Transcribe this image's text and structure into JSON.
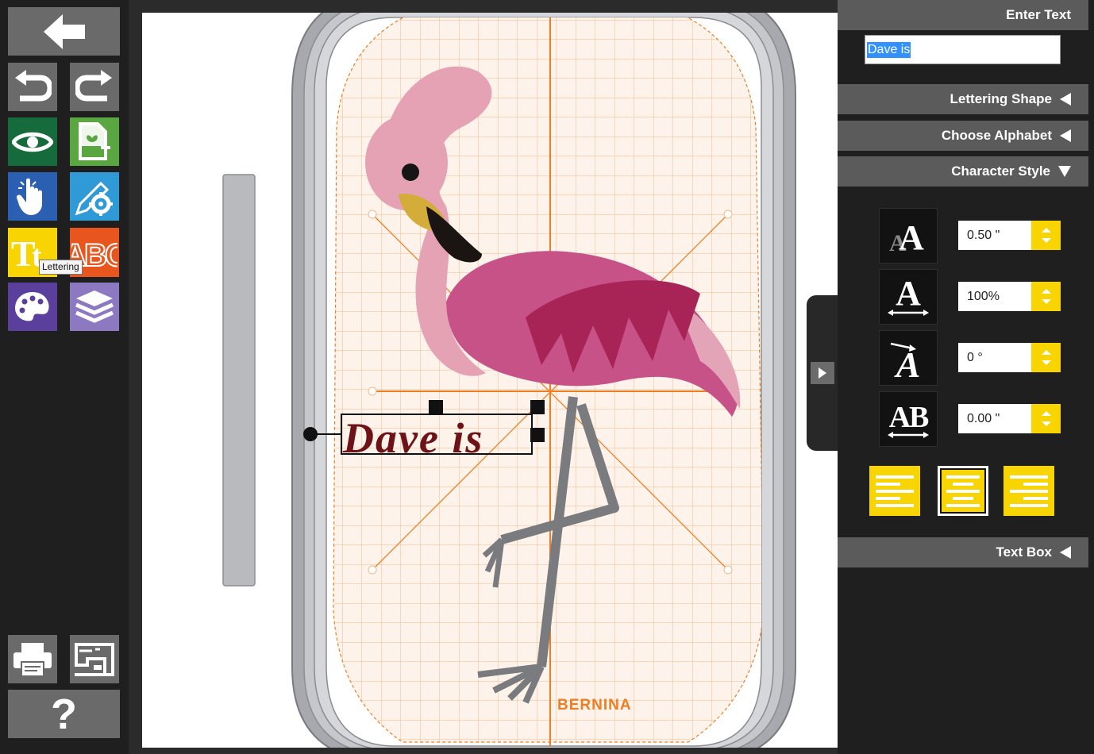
{
  "toolbar": {
    "back": "back-arrow-icon",
    "undo": "undo-icon",
    "redo": "redo-icon",
    "preview": "eye-icon",
    "new": "new-design-icon",
    "select": "hand-pointer-icon",
    "edit": "edit-gear-icon",
    "lettering": "lettering-icon",
    "monogram": "monogram-icon",
    "colors": "palette-icon",
    "layers": "layers-icon",
    "print": "printer-icon",
    "machine": "sewing-machine-icon",
    "help_label": "?",
    "tooltip": "Lettering"
  },
  "canvas": {
    "lettering_text": "Dave is",
    "brand_label": "BERNINA"
  },
  "panel": {
    "enter_text": {
      "title": "Enter Text",
      "value": "Dave is"
    },
    "sections": {
      "lettering_shape": "Lettering Shape",
      "choose_alphabet": "Choose Alphabet",
      "character_style": "Character Style",
      "text_box": "Text Box"
    },
    "character_style": {
      "size": "0.50 \"",
      "width": "100%",
      "slant": "0 °",
      "spacing": "0.00 \""
    },
    "alignment": {
      "options": [
        "left",
        "center",
        "right"
      ],
      "selected": "center"
    }
  },
  "colors": {
    "accent_yellow": "#f8d400",
    "brand_orange": "#ef7d22",
    "panel_header": "#5b5b5b",
    "lettering": "#6e1218"
  }
}
